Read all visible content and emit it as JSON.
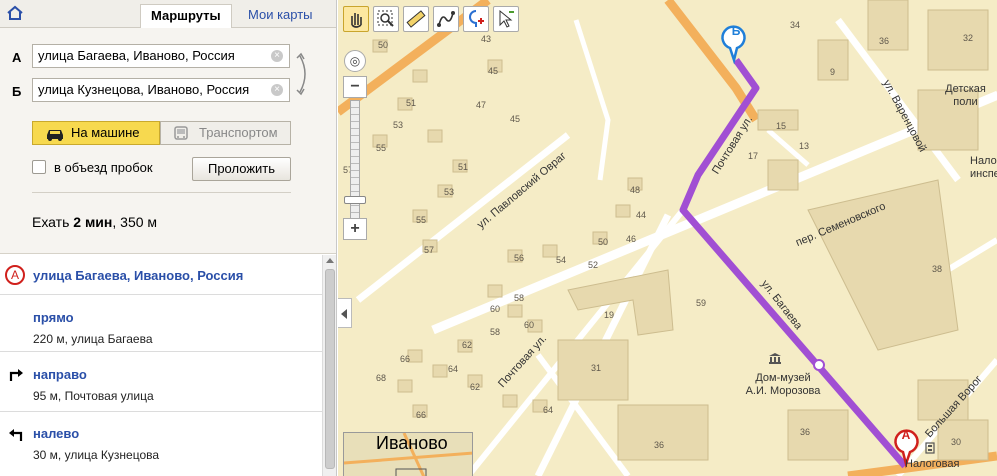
{
  "tabs": {
    "routes": "Маршруты",
    "my_maps": "Мои карты"
  },
  "route": {
    "from_label": "А",
    "to_label": "Б",
    "from_value": "улица Багаева, Иваново, Россия",
    "to_value": "улица Кузнецова, Иваново, Россия"
  },
  "modes": {
    "car": "На машине",
    "transit": "Транспортом"
  },
  "options": {
    "avoid_traffic": "в объезд пробок",
    "build": "Проложить"
  },
  "summary": {
    "prefix": "Ехать ",
    "time": "2 мин",
    "distance": ", 350 м"
  },
  "steps": [
    {
      "title": "улица Багаева, Иваново, Россия",
      "desc": ""
    },
    {
      "title": "прямо",
      "desc": "220 м, улица Багаева"
    },
    {
      "title": "направо",
      "desc": "95 м, Почтовая улица"
    },
    {
      "title": "налево",
      "desc": "30 м, улица Кузнецова"
    }
  ],
  "map": {
    "streets": {
      "pochtovaya_top": "Почтовая ул.",
      "pochtovaya_bottom": "Почтовая ул.",
      "bagaeva": "ул. Багаева",
      "pavlovsky": "ул. Павловский Овраг",
      "varentsovoy": "ул. Варенцовой",
      "semenovskogo": "пер. Семеновского",
      "bolshaya": "Большая Ворог"
    },
    "poi": {
      "museum_line1": "Дом-музей",
      "museum_line2": "А.И. Морозова",
      "detskaya": "Детская поли",
      "nalog1": "Налоговая",
      "nalog2": "инспе",
      "nalogovaya_bottom": "Налоговая"
    },
    "markers": {
      "a": "А",
      "b": "Б"
    },
    "minimap_city": "Иваново",
    "building_numbers": [
      "43",
      "50",
      "45",
      "51",
      "47",
      "53",
      "45",
      "55",
      "51",
      "53",
      "57",
      "55",
      "57",
      "56",
      "54",
      "52",
      "50",
      "48",
      "44",
      "46",
      "58",
      "60",
      "58",
      "62",
      "60",
      "66",
      "64",
      "62",
      "68",
      "66",
      "64",
      "19",
      "59",
      "31",
      "36",
      "17",
      "15",
      "13",
      "9",
      "34",
      "36",
      "32",
      "38",
      "36",
      "30"
    ],
    "route_color": "#a14fd3"
  }
}
